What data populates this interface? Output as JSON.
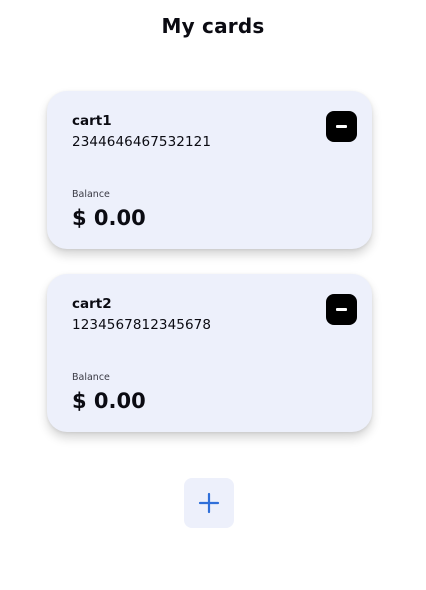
{
  "header": {
    "title": "My cards"
  },
  "cards": [
    {
      "name": "cart1",
      "number": "2344646467532121",
      "balance_label": "Balance",
      "balance": "$ 0.00",
      "remove_icon": "minus-icon"
    },
    {
      "name": "cart2",
      "number": "1234567812345678",
      "balance_label": "Balance",
      "balance": "$ 0.00",
      "remove_icon": "minus-icon"
    }
  ],
  "add_button": {
    "icon": "plus-icon",
    "icon_color": "#2f6fd9"
  },
  "colors": {
    "card_background": "#edf0fb",
    "remove_button": "#000000",
    "accent": "#2f6fd9"
  }
}
